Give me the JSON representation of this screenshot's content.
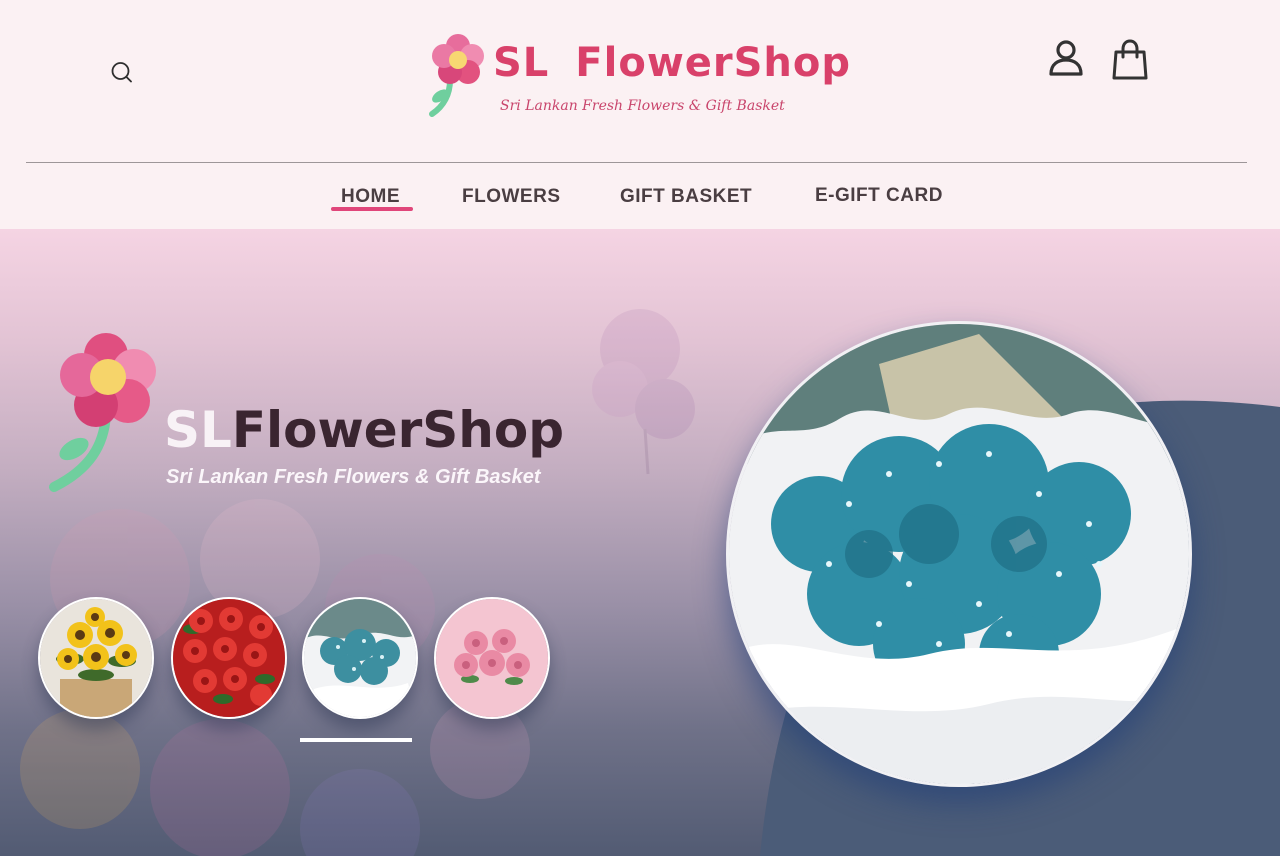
{
  "brand": {
    "title_left": "SL",
    "title_right": "FlowerShop",
    "tagline": "Sri Lankan Fresh Flowers & Gift Basket",
    "accent_color": "#d9416a"
  },
  "header": {
    "icons": {
      "search": "search-icon",
      "account": "user-icon",
      "cart": "shopping-bag-icon"
    }
  },
  "nav": {
    "items": [
      {
        "label": "HOME",
        "active": true
      },
      {
        "label": "FLOWERS",
        "active": false
      },
      {
        "label": "GIFT BASKET",
        "active": false
      },
      {
        "label": "E-GIFT CARD",
        "active": false
      }
    ],
    "active_color": "#e0467a"
  },
  "hero": {
    "title_left": "SL",
    "title_right": "FlowerShop",
    "tagline": "Sri Lankan Fresh Flowers & Gift Basket",
    "thumbnails": [
      {
        "subject": "sunflower bouquet"
      },
      {
        "subject": "red roses"
      },
      {
        "subject": "blue baby's breath bouquet",
        "selected": true
      },
      {
        "subject": "pink roses"
      }
    ],
    "featured_subject": "blue baby's breath bouquet"
  }
}
